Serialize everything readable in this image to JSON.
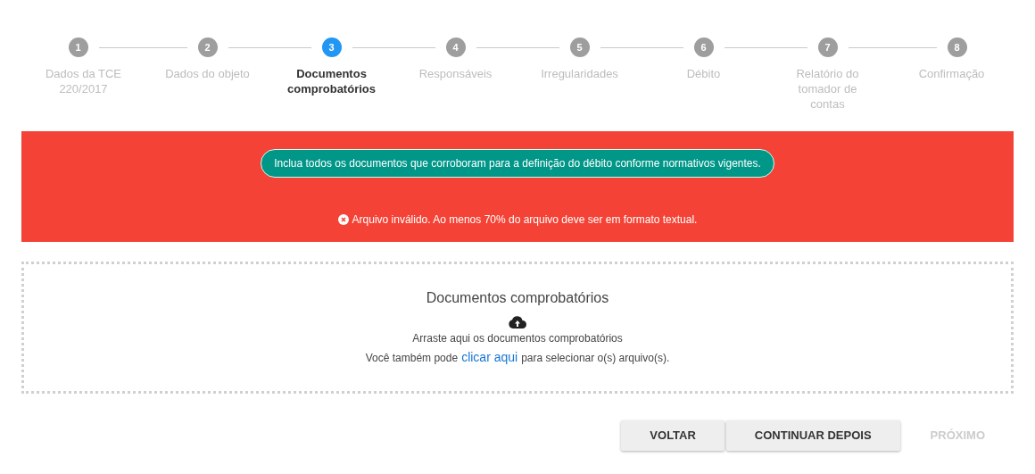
{
  "steps": [
    {
      "number": "1",
      "label": "Dados da TCE 220/2017",
      "selected": false
    },
    {
      "number": "2",
      "label": "Dados do objeto",
      "selected": false
    },
    {
      "number": "3",
      "label": "Documentos comprobatórios",
      "selected": true
    },
    {
      "number": "4",
      "label": "Responsáveis",
      "selected": false
    },
    {
      "number": "5",
      "label": "Irregularidades",
      "selected": false
    },
    {
      "number": "6",
      "label": "Débito",
      "selected": false
    },
    {
      "number": "7",
      "label": "Relatório do tomador de contas",
      "selected": false
    },
    {
      "number": "8",
      "label": "Confirmação",
      "selected": false
    }
  ],
  "alert": {
    "hint": "Inclua todos os documentos que corroboram para a definição do débito conforme normativos vigentes.",
    "error": "Arquivo inválido. Ao menos 70% do arquivo deve ser em formato textual."
  },
  "dropzone": {
    "title": "Documentos comprobatórios",
    "instruction": "Arraste aqui os documentos comprobatórios",
    "text_before": "Você também pode",
    "link": "clicar aqui",
    "text_after": "para selecionar o(s) arquivo(s)."
  },
  "buttons": [
    {
      "label": "VOLTAR",
      "disabled": false
    },
    {
      "label": "CONTINUAR DEPOIS",
      "disabled": false
    },
    {
      "label": "PRÓXIMO",
      "disabled": true
    }
  ]
}
